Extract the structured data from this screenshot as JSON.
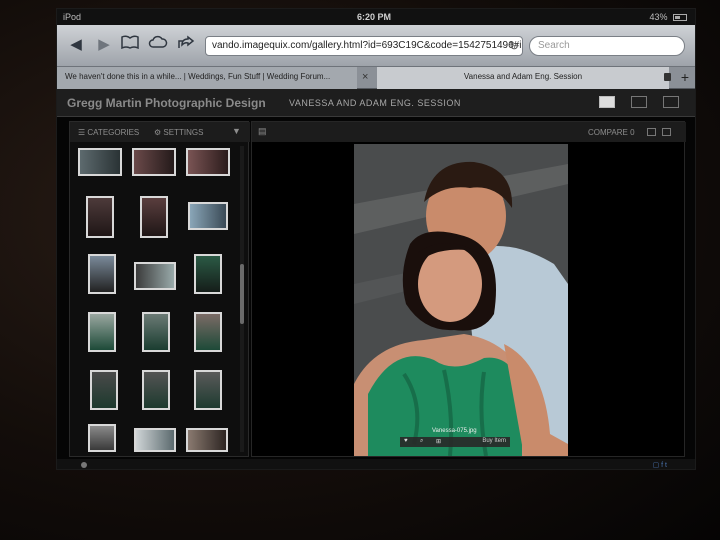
{
  "status_bar": {
    "device": "iPod",
    "time": "6:20 PM",
    "battery": "43%"
  },
  "browser": {
    "url": "vando.imagequix.com/gallery.html?id=693C19C&code=1542751496#imag",
    "search_placeholder": "Search",
    "tabs": [
      {
        "label": "We haven't done this in a while... | Weddings, Fun Stuff | Wedding Forum..."
      },
      {
        "label": "Vanessa and Adam Eng. Session"
      }
    ]
  },
  "gallery": {
    "brand": "Gregg Martin Photographic Design",
    "session_title": "VANESSA AND ADAM ENG. SESSION",
    "sidebar": {
      "categories_label": "CATEGORIES",
      "settings_label": "SETTINGS"
    },
    "viewer": {
      "compare_label": "COMPARE",
      "compare_count": "0",
      "caption": "Vanessa-075.jpg",
      "buy_label": "Buy Item"
    }
  },
  "colors": {
    "dark_bg": "#050505",
    "toolbar": "#bdc1c6",
    "dress": "#1e8b5e",
    "shirt": "#b8c9d6"
  }
}
